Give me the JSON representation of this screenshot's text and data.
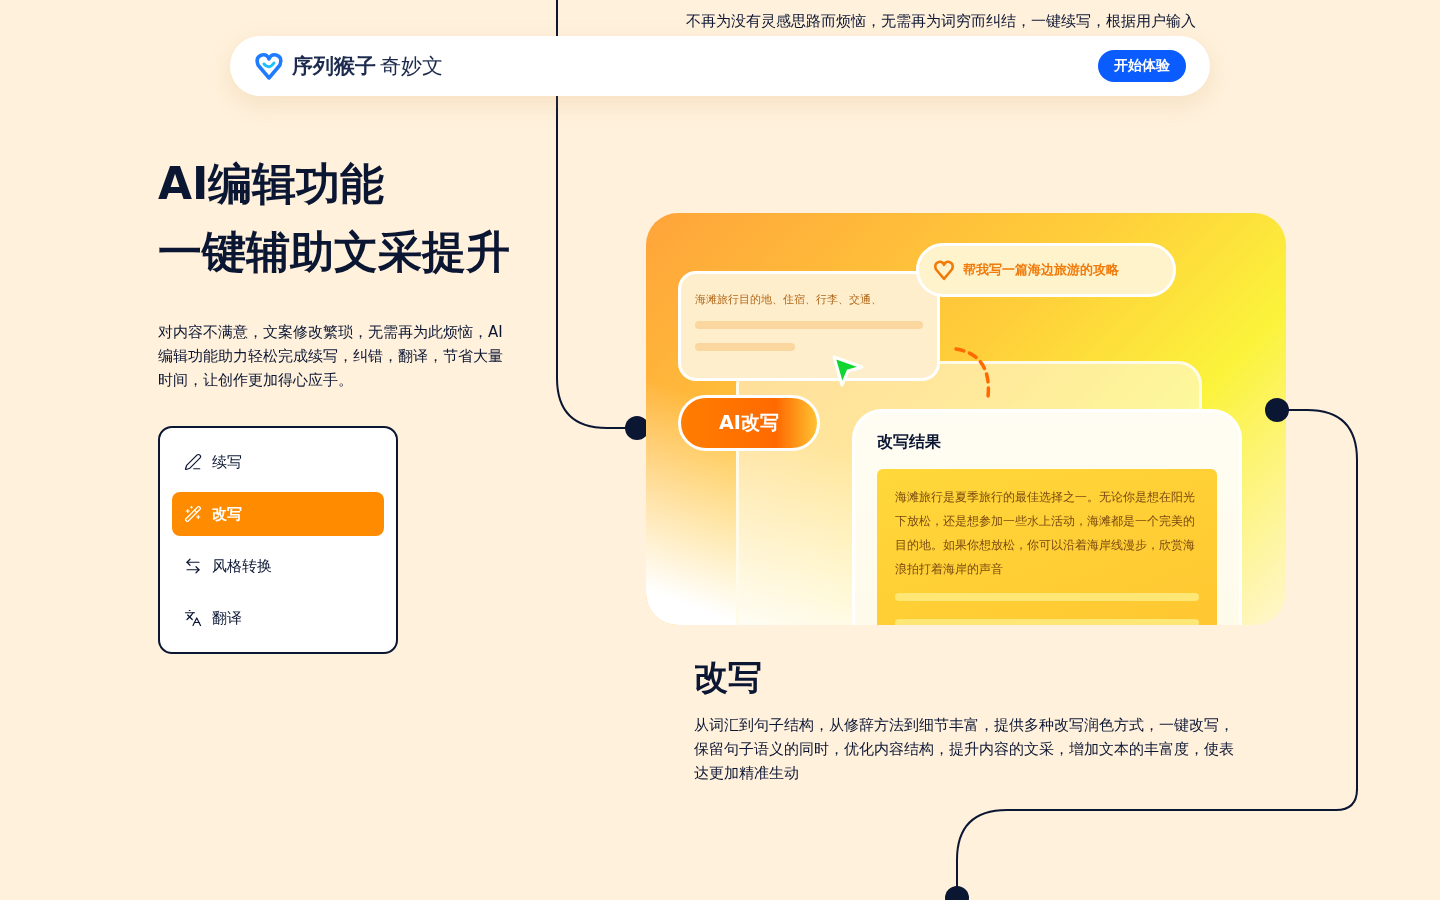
{
  "top_text": "不再为没有灵感思路而烦恼，无需再为词穷而纠结，一键续写，根据用户输入",
  "navbar": {
    "brand": "序列猴子",
    "product": "奇妙文",
    "cta": "开始体验"
  },
  "hero": {
    "title_lines": [
      "AI编辑功能",
      "一键辅助文采提升"
    ],
    "description": "对内容不满意，文案修改繁琐，无需再为此烦恼，AI编辑功能助力轻松完成续写，纠错，翻译，节省大量时间，让创作更加得心应手。"
  },
  "features": [
    {
      "kind": "continue",
      "label": "续写",
      "selected": false
    },
    {
      "kind": "rewrite",
      "label": "改写",
      "selected": true
    },
    {
      "kind": "style",
      "label": "风格转换",
      "selected": false
    },
    {
      "kind": "translate",
      "label": "翻译",
      "selected": false
    }
  ],
  "illustration": {
    "input_snippet": "海滩旅行目的地、住宿、行李、交通、",
    "prompt": "帮我写一篇海边旅游的攻略",
    "action": "AI改写",
    "result_title": "改写结果",
    "result_text": "海滩旅行是夏季旅行的最佳选择之一。无论你是想在阳光下放松，还是想参加一些水上活动，海滩都是一个完美的目的地。如果你想放松，你可以沿着海岸线漫步，欣赏海浪拍打着海岸的声音"
  },
  "detail": {
    "title": "改写",
    "description": "从词汇到句子结构，从修辞方法到细节丰富，提供多种改写润色方式，一键改写，保留句子语义的同时，优化内容结构，提升内容的文采，增加文本的丰富度，使表达更加精准生动"
  }
}
